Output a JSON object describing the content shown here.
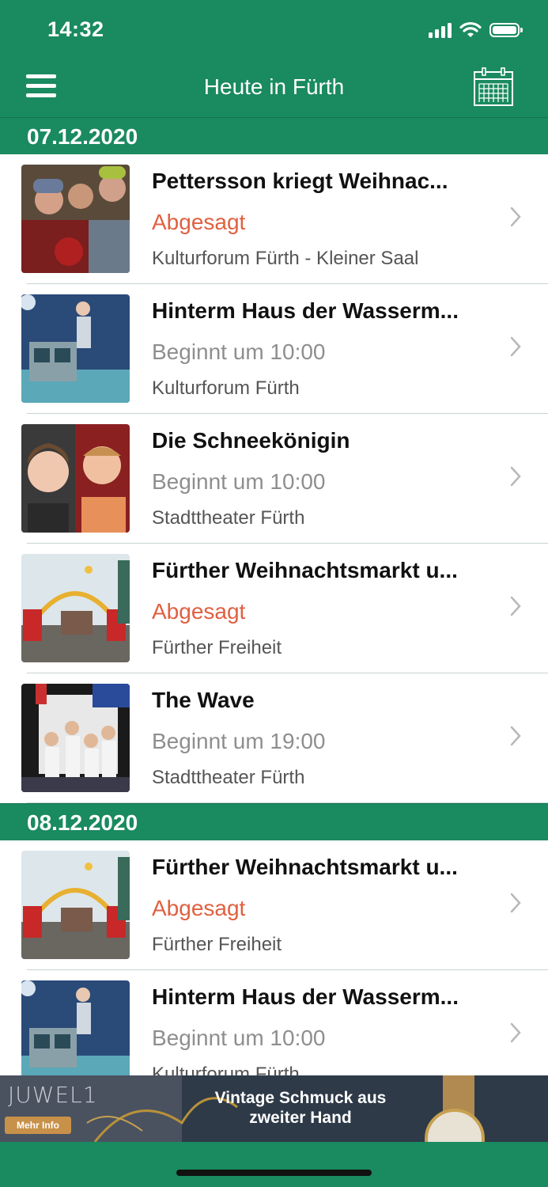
{
  "status_bar": {
    "time": "14:32"
  },
  "nav": {
    "title": "Heute in Fürth"
  },
  "sections": [
    {
      "date": "07.12.2020",
      "events": [
        {
          "title": "Pettersson kriegt Weihnac...",
          "status": "Abgesagt",
          "venue": "Kulturforum Fürth - Kleiner Saal"
        },
        {
          "title": "Hinterm Haus der Wasserm...",
          "status": "Beginnt um 10:00",
          "venue": "Kulturforum Fürth"
        },
        {
          "title": "Die Schneekönigin",
          "status": "Beginnt um 10:00",
          "venue": "Stadttheater Fürth"
        },
        {
          "title": "Fürther Weihnachtsmarkt u...",
          "status": "Abgesagt",
          "venue": "Fürther Freiheit"
        },
        {
          "title": "The Wave",
          "status": "Beginnt um 19:00",
          "venue": "Stadttheater Fürth"
        }
      ]
    },
    {
      "date": "08.12.2020",
      "events": [
        {
          "title": "Fürther Weihnachtsmarkt u...",
          "status": "Abgesagt",
          "venue": "Fürther Freiheit"
        },
        {
          "title": "Hinterm Haus der Wasserm...",
          "status": "Beginnt um 10:00",
          "venue": "Kulturforum Fürth"
        }
      ]
    }
  ],
  "banner": {
    "logo": "JUWEL1",
    "button": "Mehr Info",
    "line1": "Vintage Schmuck aus",
    "line2": "zweiter Hand"
  },
  "colors": {
    "primary": "#1a8a60",
    "cancelled": "#e06040",
    "muted": "#8e8e8e"
  }
}
